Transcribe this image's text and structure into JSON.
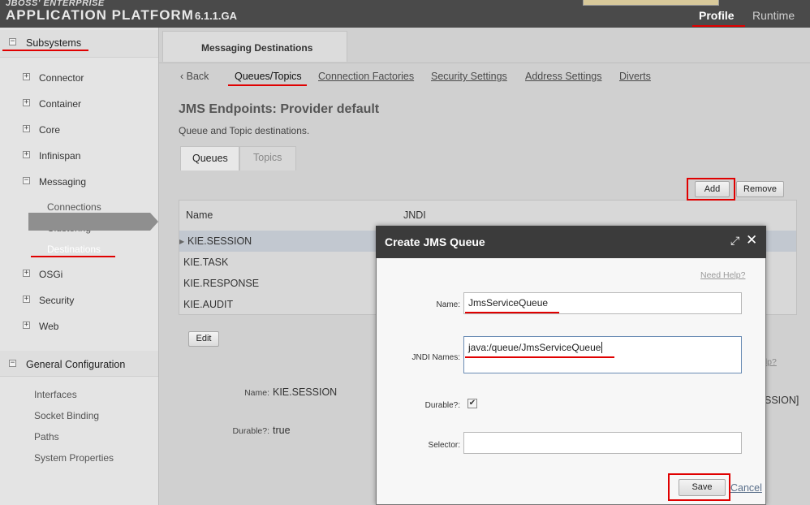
{
  "header": {
    "logo_top": "JBOSS' ENTERPRISE",
    "logo_main": "APPLICATION PLATFORM",
    "version": "6.1.1.GA",
    "tabs": [
      {
        "label": "Profile"
      },
      {
        "label": "Runtime"
      }
    ]
  },
  "sidebar": {
    "subsystems_label": "Subsystems",
    "items": [
      {
        "label": "Connector",
        "box": "+"
      },
      {
        "label": "Container",
        "box": "+"
      },
      {
        "label": "Core",
        "box": "+"
      },
      {
        "label": "Infinispan",
        "box": "+"
      },
      {
        "label": "Messaging",
        "box": "−"
      },
      {
        "label": "OSGi",
        "box": "+"
      },
      {
        "label": "Security",
        "box": "+"
      },
      {
        "label": "Web",
        "box": "+"
      }
    ],
    "messaging_children": [
      {
        "label": "Connections"
      },
      {
        "label": "Clustering"
      },
      {
        "label": "Destinations"
      }
    ],
    "general_label": "General Configuration",
    "general_items": [
      {
        "label": "Interfaces"
      },
      {
        "label": "Socket Binding"
      },
      {
        "label": "Paths"
      },
      {
        "label": "System Properties"
      }
    ],
    "collapse_box": "−"
  },
  "main": {
    "page_tab": "Messaging Destinations",
    "nav": {
      "back": "Back",
      "active": "Queues/Topics",
      "links": [
        "Connection Factories",
        "Security Settings",
        "Address Settings",
        "Diverts"
      ]
    },
    "heading": "JMS Endpoints: Provider default",
    "subheading": "Queue and Topic destinations.",
    "tabs": {
      "queues": "Queues",
      "topics": "Topics"
    },
    "buttons": {
      "add": "Add",
      "remove": "Remove",
      "edit": "Edit"
    },
    "table": {
      "columns": [
        "Name",
        "JNDI"
      ],
      "rows": [
        "KIE.SESSION",
        "KIE.TASK",
        "KIE.RESPONSE",
        "KIE.AUDIT"
      ]
    },
    "detail": {
      "name_label": "Name:",
      "name_value": "KIE.SESSION",
      "durable_label": "Durable?:",
      "durable_value": "true"
    },
    "behind_help": "elp?",
    "behind_session": "SSION]"
  },
  "dialog": {
    "title": "Create JMS Queue",
    "need_help": "Need Help?",
    "name_label": "Name:",
    "name_value": "JmsServiceQueue",
    "jndi_label": "JNDI Names:",
    "jndi_value": "java:/queue/JmsServiceQueue",
    "durable_label": "Durable?:",
    "durable_checked": "✔",
    "selector_label": "Selector:",
    "selector_value": "",
    "save": "Save",
    "cancel": "Cancel"
  },
  "colors": {
    "annotation_red": "#e00000",
    "topbar": "#4a4a4a",
    "dialog_titlebar": "#3b3b3b"
  }
}
